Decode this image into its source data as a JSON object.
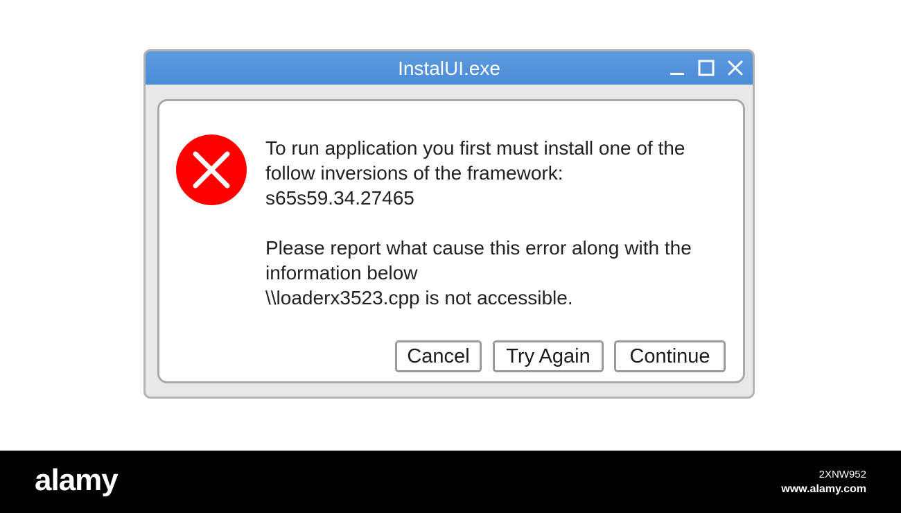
{
  "window": {
    "title": "InstalUI.exe",
    "controls": {
      "minimize": "minimize-icon",
      "maximize": "maximize-icon",
      "close": "close-icon"
    },
    "titlebar_color": "#4a8bd8"
  },
  "error": {
    "icon": "error-x-icon",
    "icon_color": "#ff0000",
    "line1": "To run application you first must install one of the",
    "line2": "follow inversions of the framework:",
    "line3": "s65s59.34.27465",
    "line4": "Please report what cause this error along with the",
    "line5": "information below",
    "line6": "\\\\loaderx3523.cpp is not accessible."
  },
  "buttons": {
    "cancel": "Cancel",
    "try_again": "Try Again",
    "continue": "Continue"
  },
  "footer": {
    "logo": "alamy",
    "image_id": "2XNW952",
    "url": "www.alamy.com"
  }
}
